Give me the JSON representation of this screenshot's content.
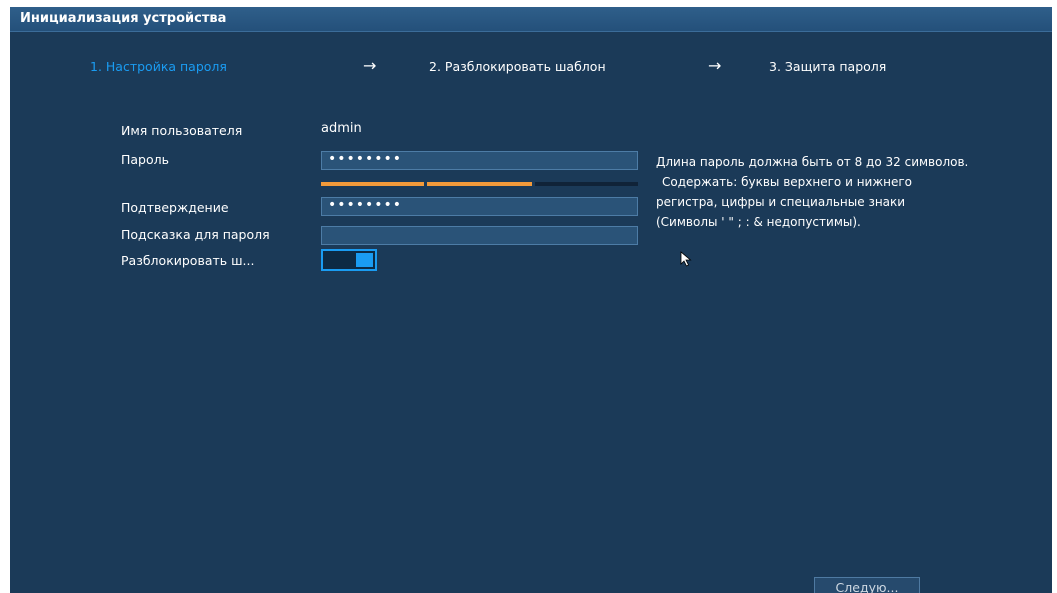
{
  "window": {
    "title": "Инициализация устройства"
  },
  "wizard": {
    "steps": [
      {
        "label": "1.  Настройка пароля",
        "active": true
      },
      {
        "label": "2.  Разблокировать шаблон",
        "active": false
      },
      {
        "label": "3.  Защита пароля",
        "active": false
      }
    ],
    "arrow": "→"
  },
  "form": {
    "username": {
      "label": "Имя пользователя",
      "value": "admin"
    },
    "password": {
      "label": "Пароль",
      "value": "••••••••"
    },
    "password_strength": {
      "filled_segments": 2,
      "total_segments": 3
    },
    "confirm": {
      "label": "Подтверждение",
      "value": "••••••••"
    },
    "password_hint": {
      "label": "Подсказка для пароля",
      "value": ""
    },
    "unlock_pattern": {
      "label": "Разблокировать ш...",
      "enabled": true
    }
  },
  "hint": {
    "lines": [
      "Длина пароль должна быть от 8 до 32 символов.",
      "Содержать: буквы верхнего и нижнего",
      "регистра, цифры и специальные знаки",
      "(Символы ' \" ; : & недопустимы)."
    ]
  },
  "footer": {
    "next_label": "Следую..."
  },
  "colors": {
    "background": "#1b3a58",
    "accent": "#1a9cf2",
    "strength": "#f39a3a"
  }
}
